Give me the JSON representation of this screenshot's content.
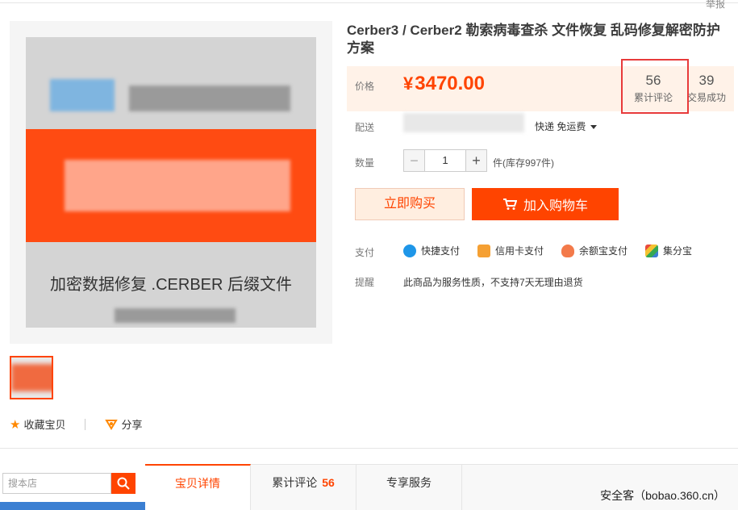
{
  "header": {
    "report_label": "举报"
  },
  "gallery": {
    "caption": "加密数据修复  .CERBER 后缀文件"
  },
  "product": {
    "title": "Cerber3 / Cerber2 勒索病毒查杀 文件恢复 乱码修复解密防护方案",
    "price_label": "价格",
    "currency": "¥",
    "price": "3470.00",
    "reviews_count": "56",
    "reviews_label": "累计评论",
    "sales_count": "39",
    "sales_label": "交易成功",
    "shipping_label": "配送",
    "shipping_method": "快递 免运费",
    "quantity_label": "数量",
    "quantity_value": "1",
    "stock_text": "件(库存997件)",
    "buy_now_label": "立即购买",
    "add_to_cart_label": "加入购物车",
    "payment_label": "支付",
    "payments": [
      "快捷支付",
      "信用卡支付",
      "余额宝支付",
      "集分宝"
    ],
    "notice_label": "提醒",
    "notice_text": "此商品为服务性质，不支持7天无理由退货"
  },
  "actions": {
    "favorite_label": "收藏宝贝",
    "share_label": "分享"
  },
  "store_search": {
    "placeholder": "搜本店"
  },
  "tabs": {
    "details": "宝贝详情",
    "reviews": "累计评论",
    "reviews_count": "56",
    "services": "专享服务"
  },
  "watermark": "安全客（bobao.360.cn）",
  "colors": {
    "accent": "#ff4400",
    "price_bg": "#fff2e8",
    "highlight_box": "#e83a3a"
  }
}
